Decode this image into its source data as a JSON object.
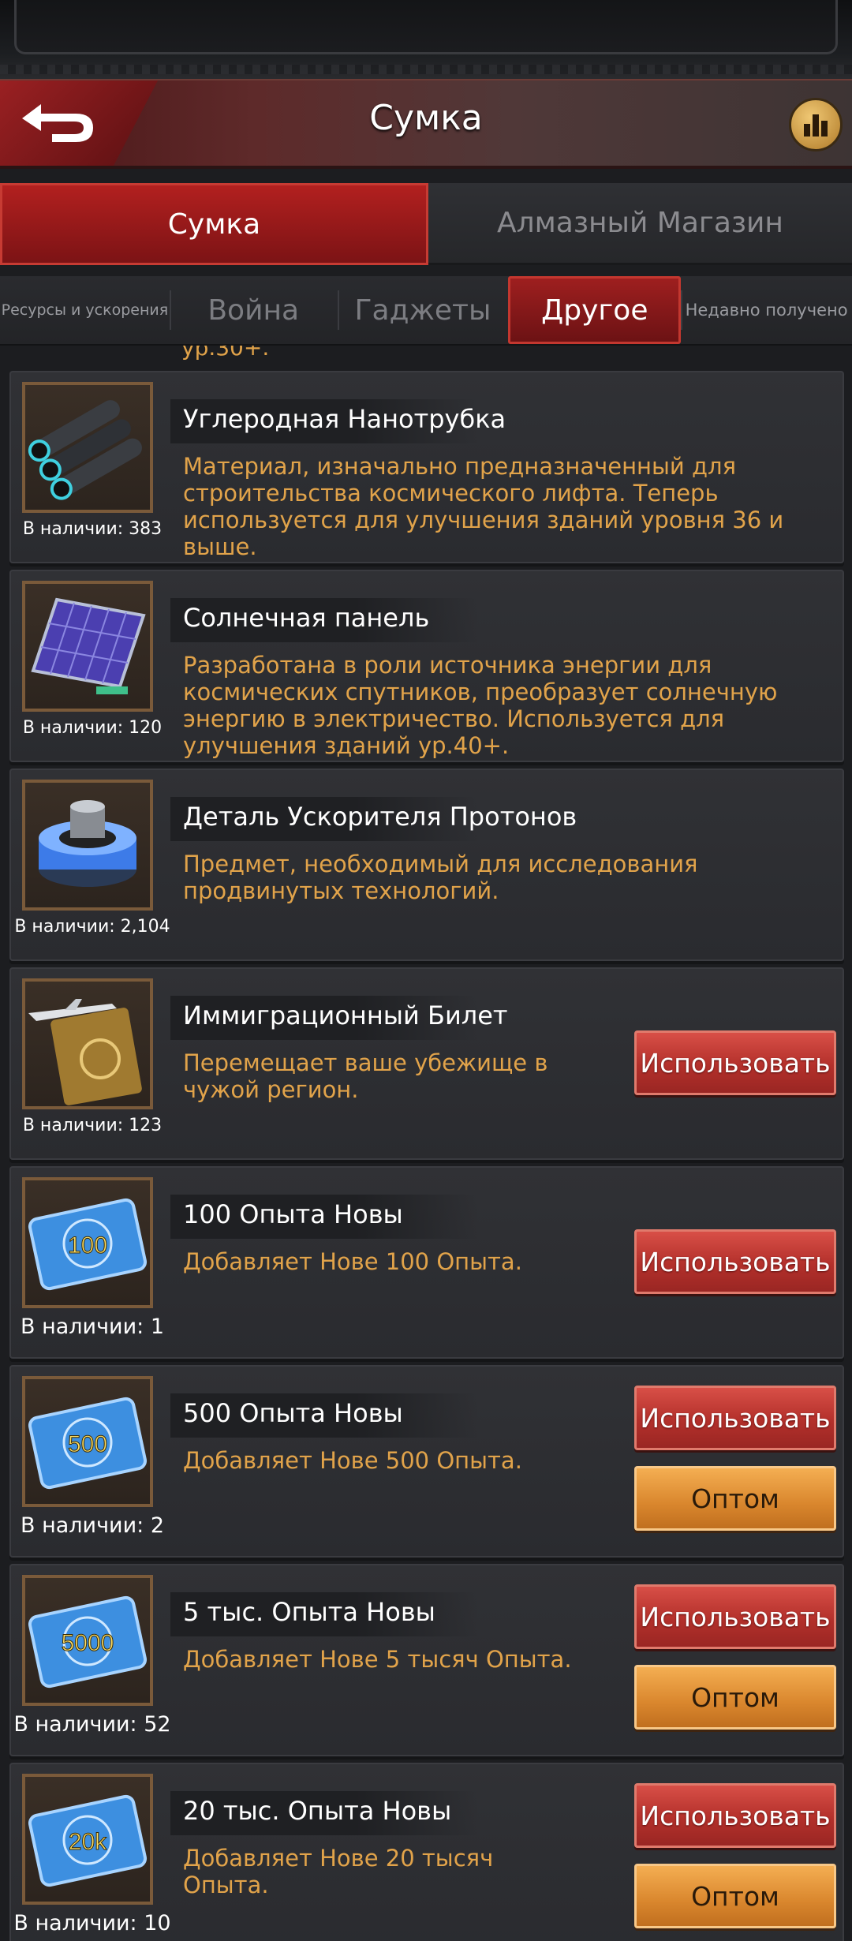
{
  "header": {
    "title": "Сумка"
  },
  "main_tabs": [
    {
      "label": "Сумка",
      "active": true
    },
    {
      "label": "Алмазный Магазин",
      "active": false
    }
  ],
  "sub_tabs": [
    {
      "label": "Ресурсы и ускорения",
      "active": false
    },
    {
      "label": "Война",
      "active": false
    },
    {
      "label": "Гаджеты",
      "active": false
    },
    {
      "label": "Другое",
      "active": true
    },
    {
      "label": "Недавно получено",
      "active": false
    }
  ],
  "partial_text": "ур.30+.",
  "items": [
    {
      "name": "Углеродная Нанотрубка",
      "desc": "Материал, изначально предназначенный для строительства космического лифта. Теперь используется для улучшения зданий уровня 36 и выше.",
      "qty": "В наличии: 383",
      "icon": "carbon-nanotube-icon"
    },
    {
      "name": "Солнечная панель",
      "desc": "Разработана в роли источника энергии для космических спутников, преобразует солнечную энергию в электричество. Используется для улучшения зданий ур.40+.",
      "qty": "В наличии: 120",
      "icon": "solar-panel-icon"
    },
    {
      "name": "Деталь Ускорителя Протонов",
      "desc": "Предмет, необходимый для исследования продвинутых технологий.",
      "qty": "В наличии: 2,104",
      "icon": "proton-accelerator-icon"
    },
    {
      "name": "Иммиграционный Билет",
      "desc": "Перемещает ваше убежище в чужой регион.",
      "qty": "В наличии: 123",
      "icon": "immigration-ticket-icon",
      "use_label": "Использовать"
    },
    {
      "name": "100 Опыта Новы",
      "desc": "Добавляет Нове 100 Опыта.",
      "qty": "В наличии: 1",
      "icon": "nova-exp-card-icon",
      "card_value": "100",
      "use_label": "Использовать"
    },
    {
      "name": "500 Опыта Новы",
      "desc": "Добавляет Нове 500 Опыта.",
      "qty": "В наличии: 2",
      "icon": "nova-exp-card-icon",
      "card_value": "500",
      "use_label": "Использовать",
      "bulk_label": "Оптом"
    },
    {
      "name": "5 тыс. Опыта Новы",
      "desc": "Добавляет Нове 5 тысяч Опыта.",
      "qty": "В наличии: 52",
      "icon": "nova-exp-card-icon",
      "card_value": "5000",
      "use_label": "Использовать",
      "bulk_label": "Оптом"
    },
    {
      "name": "20 тыс. Опыта Новы",
      "desc": "Добавляет Нове 20 тысяч Опыта.",
      "qty": "В наличии: 10",
      "icon": "nova-exp-card-icon",
      "card_value": "20k",
      "use_label": "Использовать",
      "bulk_label": "Оптом"
    }
  ]
}
